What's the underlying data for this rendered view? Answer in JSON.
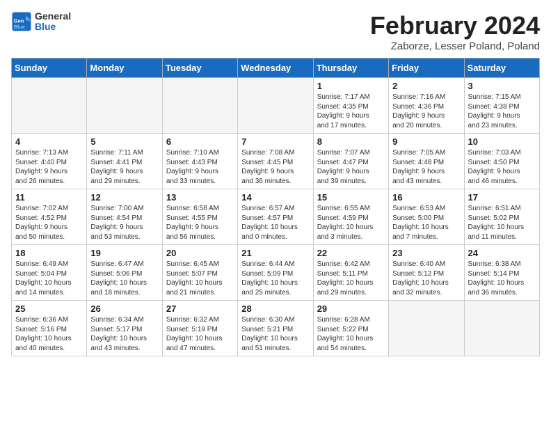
{
  "header": {
    "logo_general": "General",
    "logo_blue": "Blue",
    "title": "February 2024",
    "subtitle": "Zaborze, Lesser Poland, Poland"
  },
  "weekdays": [
    "Sunday",
    "Monday",
    "Tuesday",
    "Wednesday",
    "Thursday",
    "Friday",
    "Saturday"
  ],
  "weeks": [
    [
      {
        "day": "",
        "info": ""
      },
      {
        "day": "",
        "info": ""
      },
      {
        "day": "",
        "info": ""
      },
      {
        "day": "",
        "info": ""
      },
      {
        "day": "1",
        "info": "Sunrise: 7:17 AM\nSunset: 4:35 PM\nDaylight: 9 hours\nand 17 minutes."
      },
      {
        "day": "2",
        "info": "Sunrise: 7:16 AM\nSunset: 4:36 PM\nDaylight: 9 hours\nand 20 minutes."
      },
      {
        "day": "3",
        "info": "Sunrise: 7:15 AM\nSunset: 4:38 PM\nDaylight: 9 hours\nand 23 minutes."
      }
    ],
    [
      {
        "day": "4",
        "info": "Sunrise: 7:13 AM\nSunset: 4:40 PM\nDaylight: 9 hours\nand 26 minutes."
      },
      {
        "day": "5",
        "info": "Sunrise: 7:11 AM\nSunset: 4:41 PM\nDaylight: 9 hours\nand 29 minutes."
      },
      {
        "day": "6",
        "info": "Sunrise: 7:10 AM\nSunset: 4:43 PM\nDaylight: 9 hours\nand 33 minutes."
      },
      {
        "day": "7",
        "info": "Sunrise: 7:08 AM\nSunset: 4:45 PM\nDaylight: 9 hours\nand 36 minutes."
      },
      {
        "day": "8",
        "info": "Sunrise: 7:07 AM\nSunset: 4:47 PM\nDaylight: 9 hours\nand 39 minutes."
      },
      {
        "day": "9",
        "info": "Sunrise: 7:05 AM\nSunset: 4:48 PM\nDaylight: 9 hours\nand 43 minutes."
      },
      {
        "day": "10",
        "info": "Sunrise: 7:03 AM\nSunset: 4:50 PM\nDaylight: 9 hours\nand 46 minutes."
      }
    ],
    [
      {
        "day": "11",
        "info": "Sunrise: 7:02 AM\nSunset: 4:52 PM\nDaylight: 9 hours\nand 50 minutes."
      },
      {
        "day": "12",
        "info": "Sunrise: 7:00 AM\nSunset: 4:54 PM\nDaylight: 9 hours\nand 53 minutes."
      },
      {
        "day": "13",
        "info": "Sunrise: 6:58 AM\nSunset: 4:55 PM\nDaylight: 9 hours\nand 56 minutes."
      },
      {
        "day": "14",
        "info": "Sunrise: 6:57 AM\nSunset: 4:57 PM\nDaylight: 10 hours\nand 0 minutes."
      },
      {
        "day": "15",
        "info": "Sunrise: 6:55 AM\nSunset: 4:59 PM\nDaylight: 10 hours\nand 3 minutes."
      },
      {
        "day": "16",
        "info": "Sunrise: 6:53 AM\nSunset: 5:00 PM\nDaylight: 10 hours\nand 7 minutes."
      },
      {
        "day": "17",
        "info": "Sunrise: 6:51 AM\nSunset: 5:02 PM\nDaylight: 10 hours\nand 11 minutes."
      }
    ],
    [
      {
        "day": "18",
        "info": "Sunrise: 6:49 AM\nSunset: 5:04 PM\nDaylight: 10 hours\nand 14 minutes."
      },
      {
        "day": "19",
        "info": "Sunrise: 6:47 AM\nSunset: 5:06 PM\nDaylight: 10 hours\nand 18 minutes."
      },
      {
        "day": "20",
        "info": "Sunrise: 6:45 AM\nSunset: 5:07 PM\nDaylight: 10 hours\nand 21 minutes."
      },
      {
        "day": "21",
        "info": "Sunrise: 6:44 AM\nSunset: 5:09 PM\nDaylight: 10 hours\nand 25 minutes."
      },
      {
        "day": "22",
        "info": "Sunrise: 6:42 AM\nSunset: 5:11 PM\nDaylight: 10 hours\nand 29 minutes."
      },
      {
        "day": "23",
        "info": "Sunrise: 6:40 AM\nSunset: 5:12 PM\nDaylight: 10 hours\nand 32 minutes."
      },
      {
        "day": "24",
        "info": "Sunrise: 6:38 AM\nSunset: 5:14 PM\nDaylight: 10 hours\nand 36 minutes."
      }
    ],
    [
      {
        "day": "25",
        "info": "Sunrise: 6:36 AM\nSunset: 5:16 PM\nDaylight: 10 hours\nand 40 minutes."
      },
      {
        "day": "26",
        "info": "Sunrise: 6:34 AM\nSunset: 5:17 PM\nDaylight: 10 hours\nand 43 minutes."
      },
      {
        "day": "27",
        "info": "Sunrise: 6:32 AM\nSunset: 5:19 PM\nDaylight: 10 hours\nand 47 minutes."
      },
      {
        "day": "28",
        "info": "Sunrise: 6:30 AM\nSunset: 5:21 PM\nDaylight: 10 hours\nand 51 minutes."
      },
      {
        "day": "29",
        "info": "Sunrise: 6:28 AM\nSunset: 5:22 PM\nDaylight: 10 hours\nand 54 minutes."
      },
      {
        "day": "",
        "info": ""
      },
      {
        "day": "",
        "info": ""
      }
    ]
  ]
}
